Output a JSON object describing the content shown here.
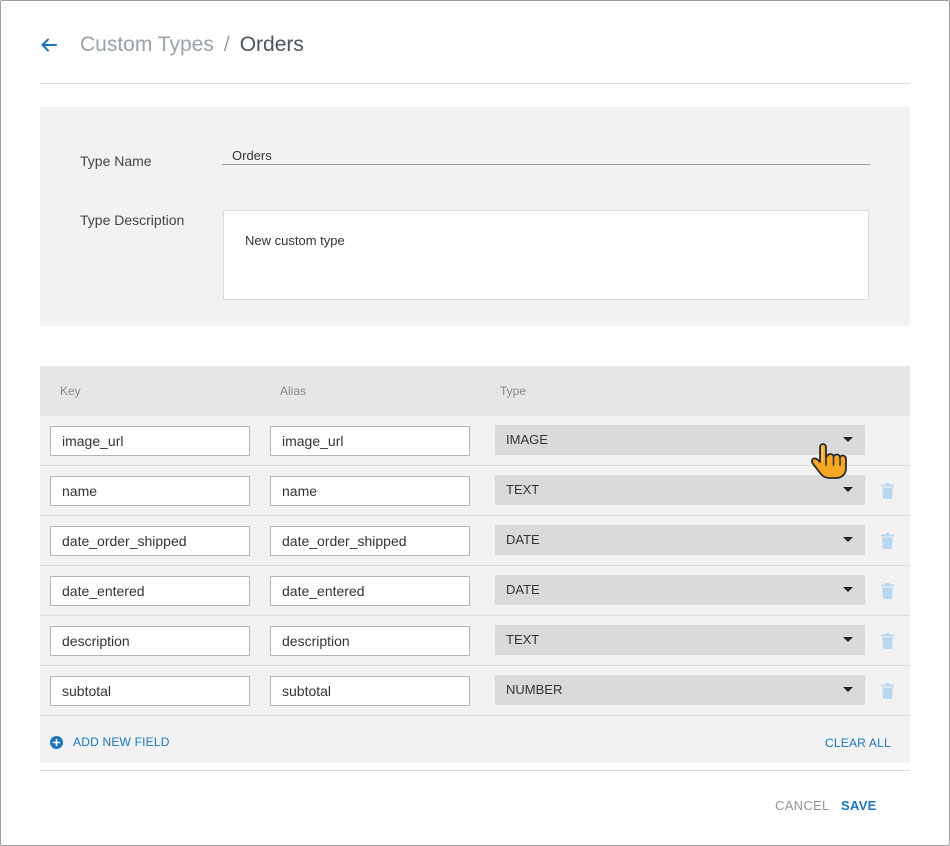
{
  "breadcrumb": {
    "parent": "Custom Types",
    "separator": "/",
    "current": "Orders"
  },
  "details": {
    "type_name_label": "Type Name",
    "type_name_value": "Orders",
    "type_description_label": "Type Description",
    "type_description_value": "New custom type"
  },
  "table": {
    "headers": {
      "key": "Key",
      "alias": "Alias",
      "type": "Type"
    },
    "rows": [
      {
        "key": "image_url",
        "alias": "image_url",
        "type": "IMAGE",
        "deletable": false
      },
      {
        "key": "name",
        "alias": "name",
        "type": "TEXT",
        "deletable": true
      },
      {
        "key": "date_order_shipped",
        "alias": "date_order_shipped",
        "type": "DATE",
        "deletable": true
      },
      {
        "key": "date_entered",
        "alias": "date_entered",
        "type": "DATE",
        "deletable": true
      },
      {
        "key": "description",
        "alias": "description",
        "type": "TEXT",
        "deletable": true
      },
      {
        "key": "subtotal",
        "alias": "subtotal",
        "type": "NUMBER",
        "deletable": true
      }
    ],
    "add_field_label": "ADD NEW FIELD",
    "clear_all_label": "CLEAR ALL"
  },
  "footer": {
    "cancel_label": "CANCEL",
    "save_label": "SAVE"
  },
  "colors": {
    "accent": "#1b75bb",
    "trash": "#b9d7ee",
    "panel": "#f2f2f2",
    "cursor": "#f5a623"
  },
  "icons": {
    "back": "arrow-left-icon",
    "delete": "trash-icon",
    "add": "plus-circle-icon",
    "dropdown": "caret-down-icon",
    "pointer": "hand-pointer-icon"
  }
}
